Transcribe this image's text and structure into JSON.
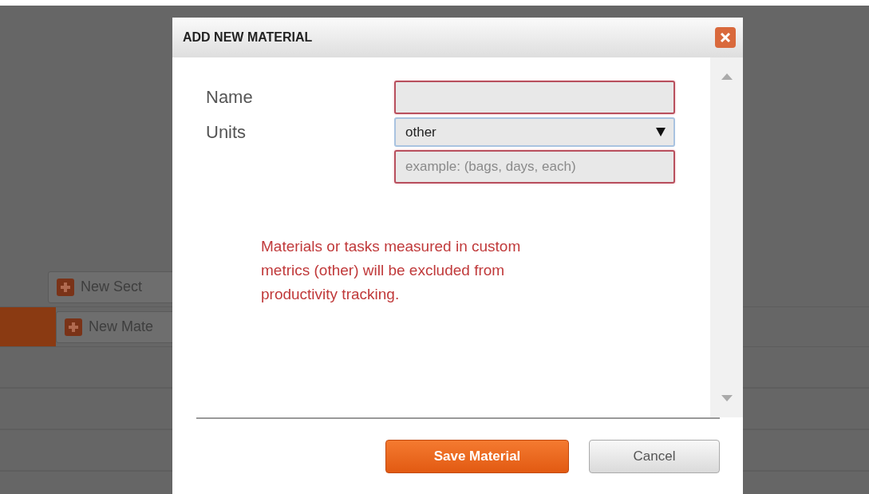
{
  "background": {
    "rows": [
      {
        "button": "New Sect",
        "selected": false
      },
      {
        "button": "New Mate",
        "selected": true
      }
    ]
  },
  "dialog": {
    "title": "ADD NEW MATERIAL",
    "fields": [
      {
        "kind": "text",
        "label": "Name",
        "invalid": true
      },
      {
        "kind": "select",
        "label": "Units",
        "value": "other",
        "invalid": false
      },
      {
        "kind": "text",
        "placeholder": "example: (bags, days, each)",
        "invalid": true
      }
    ],
    "message": "Materials or tasks measured in custom metrics (other)  will be excluded from productivity tracking.",
    "buttons": [
      {
        "label": "Save Material",
        "kind": "primary"
      },
      {
        "label": "Cancel",
        "kind": "secondary"
      }
    ]
  }
}
